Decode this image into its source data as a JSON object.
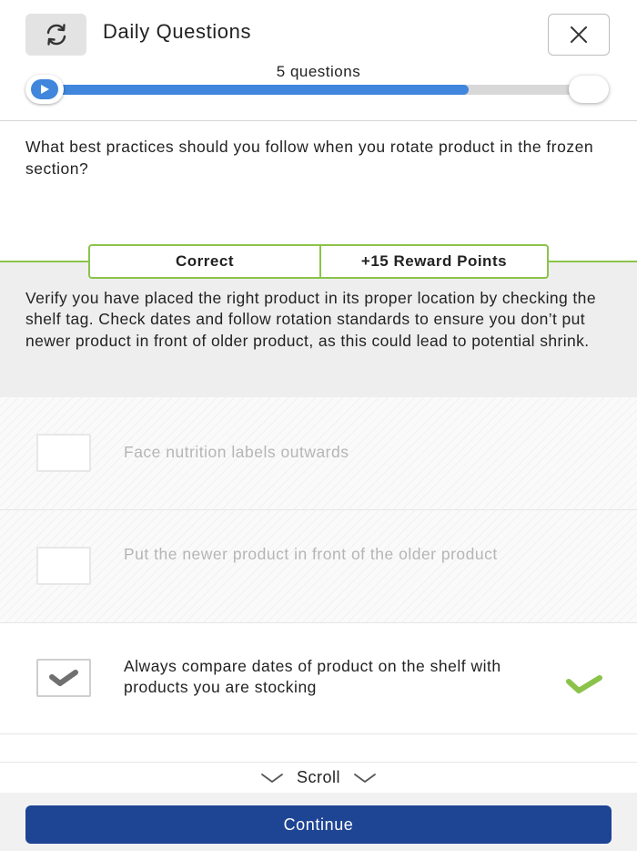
{
  "header": {
    "title": "Daily Questions",
    "refresh_icon": "refresh-icon",
    "close_icon": "close-icon",
    "question_count_label": "5 questions",
    "progress_fraction": 0.78
  },
  "question": {
    "text": "What best practices should you follow when you rotate product in the frozen section?"
  },
  "feedback": {
    "result": "Correct",
    "points": "+15 Reward Points",
    "explanation": "Verify you have placed the right product in its proper location by checking the shelf tag. Check dates and follow rotation standards to ensure you don’t put newer product in front of older product, as this could lead to potential shrink."
  },
  "options": [
    {
      "text": "Face nutrition labels outwards",
      "checked": false,
      "correct": false,
      "disabled": true
    },
    {
      "text": "Put the newer product in front of the older product",
      "checked": false,
      "correct": false,
      "disabled": true
    },
    {
      "text": "Always compare dates of product on the shelf with products you are stocking",
      "checked": true,
      "correct": true,
      "disabled": false
    }
  ],
  "scroll": {
    "label": "Scroll",
    "icon": "chevron-down-icon"
  },
  "footer": {
    "continue_label": "Continue"
  },
  "colors": {
    "accent_blue": "#3f86dc",
    "button_navy": "#1e4494",
    "correct_green": "#8bc34a",
    "check_gray": "#707070"
  }
}
